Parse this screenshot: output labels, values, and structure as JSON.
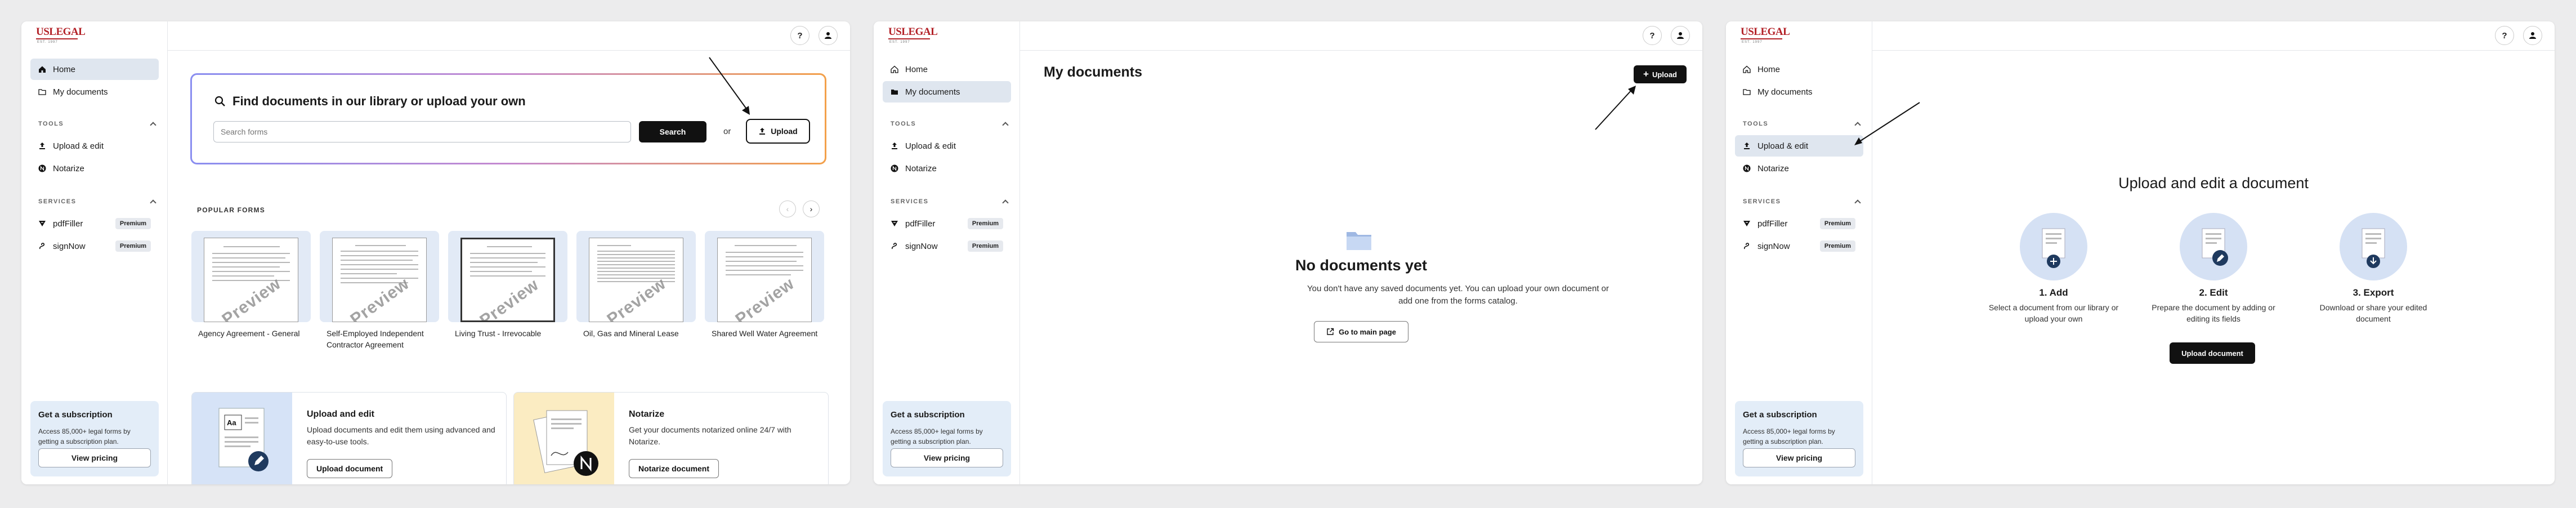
{
  "logo": {
    "text": "USLEGAL",
    "sub": "EST. 1997"
  },
  "topbar": {
    "help": "?"
  },
  "sidebar": {
    "home": "Home",
    "my_documents": "My documents",
    "tools_header": "TOOLS",
    "upload_edit": "Upload & edit",
    "notarize": "Notarize",
    "services_header": "SERVICES",
    "pdffiller": "pdfFiller",
    "signnow": "signNow",
    "premium": "Premium"
  },
  "subscription": {
    "title": "Get a subscription",
    "desc": "Access 85,000+ legal forms by getting a subscription plan.",
    "button": "View pricing"
  },
  "home": {
    "search_heading": "Find documents in our library or upload your own",
    "search_placeholder": "Search forms",
    "search_button": "Search",
    "or": "or",
    "upload_button": "Upload",
    "popular_header": "POPULAR FORMS",
    "watermark": "Preview",
    "forms": [
      "Agency Agreement - General",
      "Self-Employed Independent Contractor Agreement",
      "Living Trust - Irrevocable",
      "Oil, Gas and Mineral Lease",
      "Shared Well Water Agreement"
    ],
    "features": [
      {
        "title": "Upload and edit",
        "desc": "Upload documents and edit them using advanced and easy-to-use tools.",
        "button": "Upload document"
      },
      {
        "title": "Notarize",
        "desc": "Get your documents notarized online 24/7 with Notarize.",
        "button": "Notarize document"
      }
    ]
  },
  "mydocs": {
    "title": "My documents",
    "upload_button": "Upload",
    "empty_title": "No documents yet",
    "empty_desc": "You don't have any saved documents yet. You can upload your own document or add one from the forms catalog.",
    "main_button": "Go to main page"
  },
  "upload": {
    "title": "Upload and edit a document",
    "steps": [
      {
        "title": "1. Add",
        "desc": "Select a document from our library or upload your own"
      },
      {
        "title": "2. Edit",
        "desc": "Prepare the document by adding or editing its fields"
      },
      {
        "title": "3. Export",
        "desc": "Download or share your edited document"
      }
    ],
    "button": "Upload document"
  },
  "colors": {
    "brand": "#b32127",
    "active_nav": "#dfe6ef",
    "card_bg": "#e3edf8"
  }
}
